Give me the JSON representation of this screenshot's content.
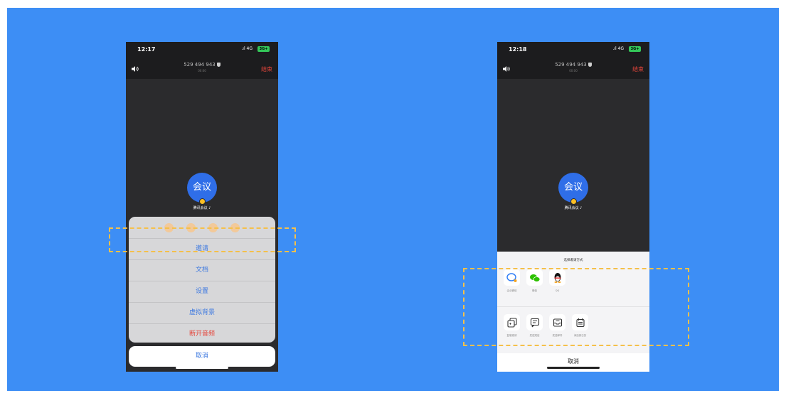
{
  "colors": {
    "background": "#3d8ef5",
    "highlight": "#f5c04a",
    "link": "#3f7ae0",
    "danger": "#e5453a"
  },
  "left_phone": {
    "status": {
      "time": "12:17",
      "network": "4G",
      "battery": "3G+"
    },
    "header": {
      "meeting_id": "529 494 943",
      "duration": "00:00",
      "end_label": "结束"
    },
    "avatar_text": "会议",
    "participant_name": "腾讯会议",
    "menu": {
      "items": [
        "邀请",
        "文档",
        "设置",
        "虚拟背景",
        "断开音频"
      ],
      "cancel": "取消"
    }
  },
  "right_phone": {
    "status": {
      "time": "12:18",
      "network": "4G",
      "battery": "3G+"
    },
    "header": {
      "meeting_id": "529 494 943",
      "duration": "00:00",
      "end_label": "结束"
    },
    "avatar_text": "会议",
    "participant_name": "腾讯会议",
    "share": {
      "title": "选择邀请方式",
      "row1": [
        {
          "label": "企业微信",
          "icon": "wecom-icon"
        },
        {
          "label": "微信",
          "icon": "wechat-icon"
        },
        {
          "label": "QQ",
          "icon": "qq-icon"
        }
      ],
      "row2": [
        {
          "label": "复制邀请",
          "icon": "copy-icon"
        },
        {
          "label": "发送短信",
          "icon": "sms-icon"
        },
        {
          "label": "发送邮件",
          "icon": "mail-icon"
        },
        {
          "label": "添加到日历",
          "icon": "calendar-icon"
        }
      ],
      "cancel": "取消"
    }
  }
}
